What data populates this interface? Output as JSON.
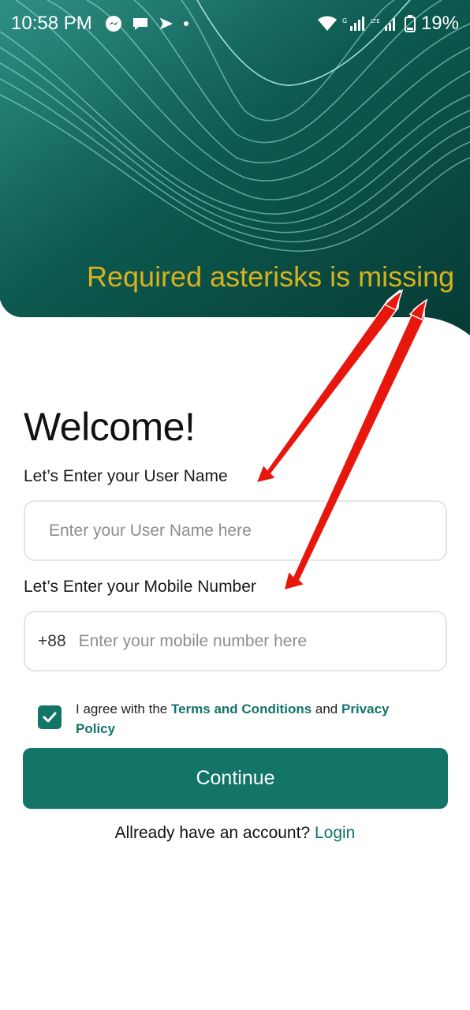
{
  "status_bar": {
    "time": "10:58 PM",
    "left_icons": [
      "messenger-icon",
      "chat-bubble-icon",
      "send-icon",
      "dot-icon"
    ],
    "right_icons": [
      "wifi-icon",
      "signal-icon",
      "lte-signal-icon",
      "battery-icon"
    ],
    "battery": "19%"
  },
  "annotation": {
    "text": "Required asterisks is missing",
    "color": "#d8b21c",
    "arrow_color": "#e8170e"
  },
  "form": {
    "title": "Welcome!",
    "user_label": "Let’s Enter your User Name",
    "user_placeholder": "Enter your User Name here",
    "mobile_label": "Let’s Enter your Mobile Number",
    "mobile_prefix": "+88",
    "mobile_placeholder": "Enter your mobile number here",
    "agree_checked": true,
    "agree_prefix": "I agree with the ",
    "terms_link": "Terms and Conditions",
    "agree_and": " and ",
    "privacy_link": "Privacy Policy",
    "continue_label": "Continue",
    "login_prompt": "Allready have an account?",
    "login_link": "Login"
  },
  "colors": {
    "primary": "#137468",
    "header_dark": "#063b34",
    "header_light": "#2a8a80"
  }
}
